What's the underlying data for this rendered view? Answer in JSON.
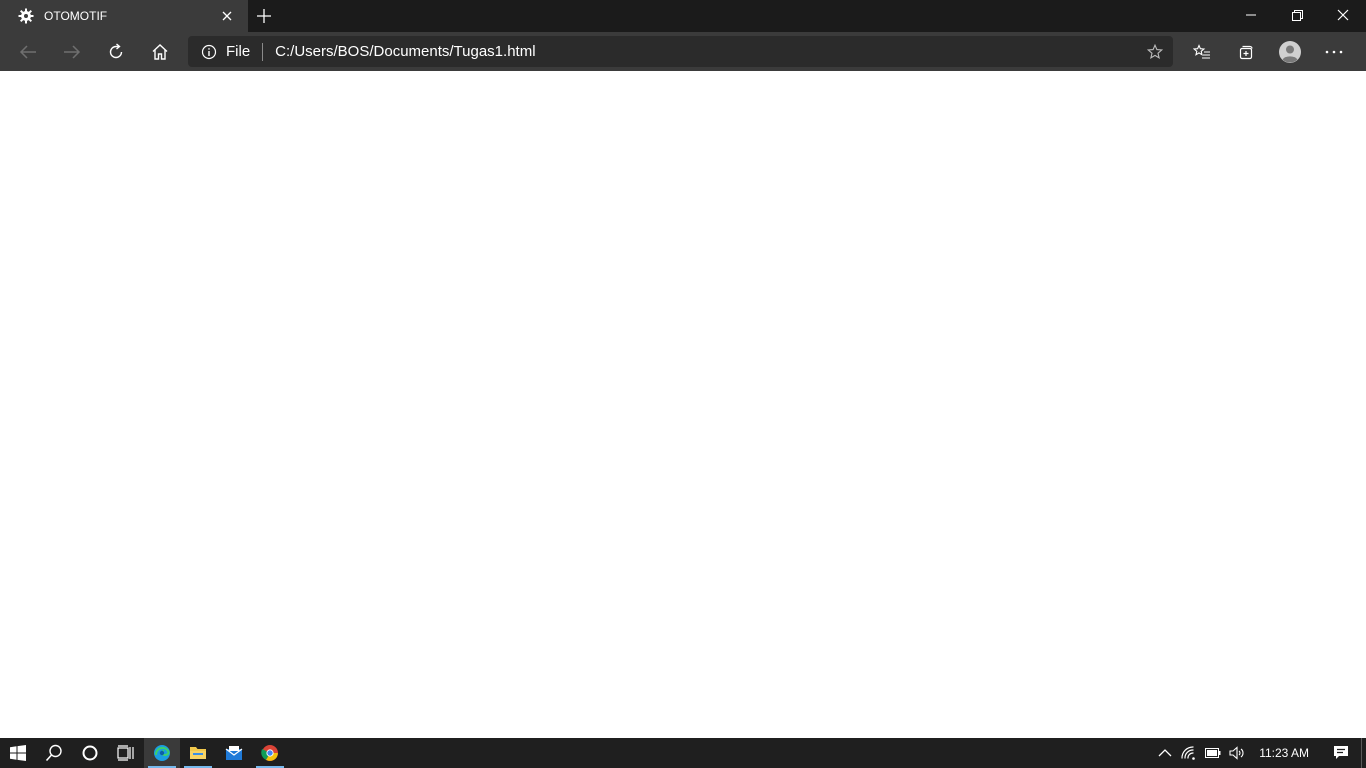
{
  "browser": {
    "tab": {
      "title": "OTOMOTIF",
      "favicon": "gear-icon"
    },
    "address_bar": {
      "scheme_label": "File",
      "url": "C:/Users/BOS/Documents/Tugas1.html"
    },
    "colors": {
      "titlebar": "#1b1b1b",
      "toolbar": "#3b3b3b",
      "omnibox": "#2b2b2b",
      "page": "#ffffff"
    }
  },
  "taskbar": {
    "clock": "11:23 AM",
    "pinned_apps": [
      "start-icon",
      "search-icon",
      "cortana-icon",
      "task-view-icon",
      "edge-icon",
      "file-explorer-icon",
      "mail-icon",
      "chrome-icon"
    ],
    "tray_icons": [
      "chevron-up-icon",
      "wifi-icon",
      "battery-icon",
      "volume-icon",
      "action-center-icon"
    ],
    "colors": {
      "background": "#1f1f1f",
      "running_indicator": "#76b9ed"
    }
  }
}
